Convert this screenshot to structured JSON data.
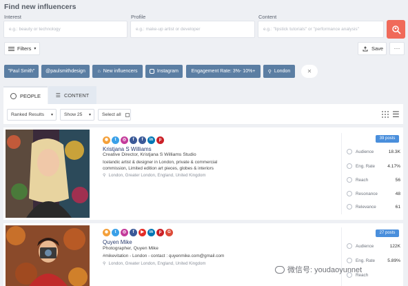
{
  "header": {
    "title": "Find new influencers"
  },
  "search": {
    "interest": {
      "label": "Interest",
      "placeholder": "e.g.: beauty or technology"
    },
    "profile": {
      "label": "Profile",
      "placeholder": "e.g.: make-up artist or developer"
    },
    "content": {
      "label": "Content",
      "placeholder": "e.g.: \"lipstick tutorials\" or \"performance analysis\""
    }
  },
  "toolbar": {
    "filters": "Filters",
    "save": "Save",
    "more": "···"
  },
  "chips": [
    "\"Paul Smith\"",
    "@paulsmithdesign",
    "New influencers",
    "Instagram",
    "Engagement Rate: 3%- 10%+",
    "London"
  ],
  "tabs": {
    "people": "PEOPLE",
    "content": "CONTENT"
  },
  "list_controls": {
    "sort": "Ranked Results",
    "show": "Show 25",
    "select_all": "Select all"
  },
  "influencers": [
    {
      "name": "Kristjana S Williams",
      "title": "Creative Director, Kristjana S Williams Studio",
      "bio": "Icelandic artist & designer in London, private & commercial commission, Limited edition art pieces, globes & interiors",
      "location": "London, Greater London, England, United Kingdom",
      "posts": "39 posts",
      "socials": [
        "rss",
        "twitter",
        "instagram",
        "facebook",
        "facebook",
        "linkedin",
        "pinterest"
      ],
      "metrics": [
        {
          "label": "Audience",
          "value": "18.3K"
        },
        {
          "label": "Eng. Rate",
          "value": "4.17%"
        },
        {
          "label": "Reach",
          "value": "56"
        },
        {
          "label": "Resonance",
          "value": "48"
        },
        {
          "label": "Relevance",
          "value": "61"
        }
      ]
    },
    {
      "name": "Quyen Mike",
      "title": "Photographer, Quyen Mike",
      "bio": "#mikevitation - London - contact : quyenmike.com@gmail.com",
      "location": "London, Greater London, England, United Kingdom",
      "posts": "27 posts",
      "socials": [
        "rss",
        "twitter",
        "instagram",
        "facebook",
        "youtube",
        "linkedin",
        "pinterest",
        "google-plus"
      ],
      "metrics": [
        {
          "label": "Audience",
          "value": "122K"
        },
        {
          "label": "Eng. Rate",
          "value": "5.89%"
        },
        {
          "label": "Reach",
          "value": ""
        }
      ]
    }
  ],
  "watermark": "微信号: youdaoyunnet",
  "colors": {
    "accent": "#5b7ea3",
    "search_button": "#f06a5a",
    "badge": "#4a8fdc",
    "name": "#2a3c6e"
  }
}
